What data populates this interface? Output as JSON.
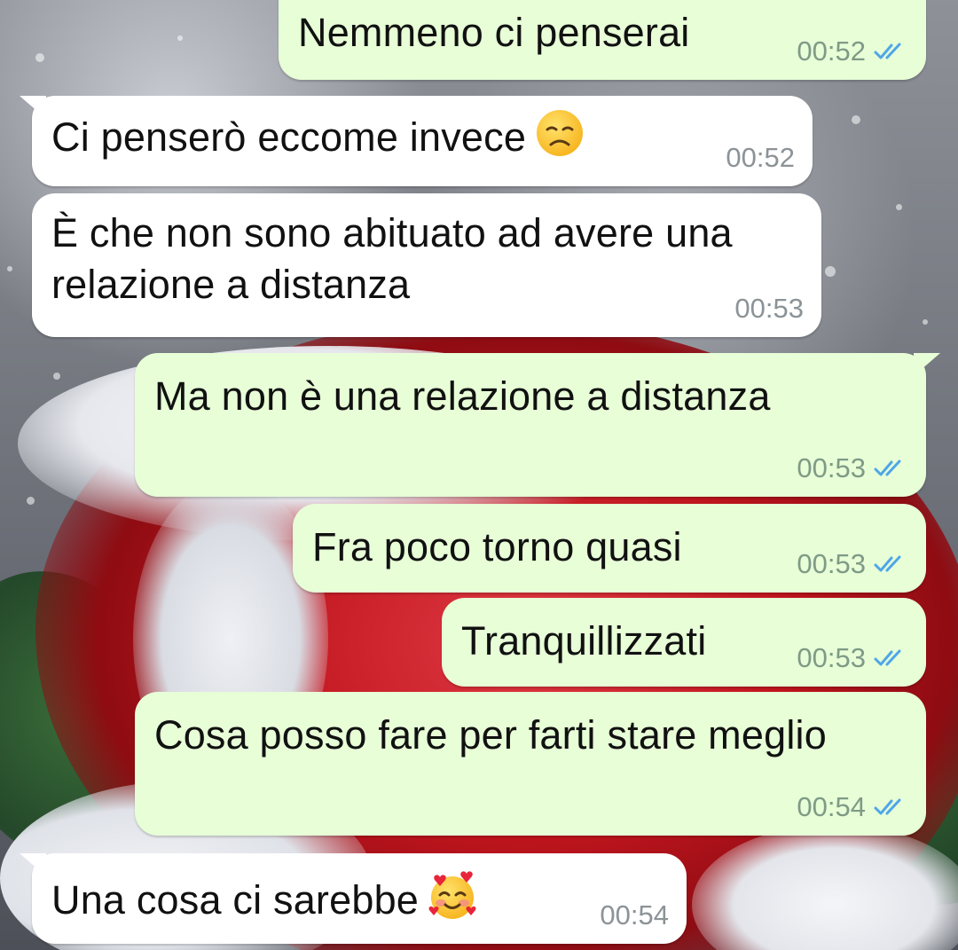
{
  "theme": {
    "incoming_bubble": "#ffffff",
    "outgoing_bubble": "#e7fed7",
    "read_tick_color": "#4fa6e8"
  },
  "messages": [
    {
      "id": "m1",
      "direction": "out",
      "text": "Nemmeno ci penserai",
      "time": "00:52",
      "status": "read"
    },
    {
      "id": "m2",
      "direction": "in",
      "text": "Ci penserò eccome invece",
      "emoji": "disappointed-face-icon",
      "time": "00:52"
    },
    {
      "id": "m3",
      "direction": "in",
      "text": "È che non sono abituato ad avere una relazione a distanza",
      "time": "00:53"
    },
    {
      "id": "m4",
      "direction": "out",
      "text": "Ma non è una relazione a distanza",
      "time": "00:53",
      "status": "read"
    },
    {
      "id": "m5",
      "direction": "out",
      "text": "Fra poco torno quasi",
      "time": "00:53",
      "status": "read"
    },
    {
      "id": "m6",
      "direction": "out",
      "text": "Tranquillizzati",
      "time": "00:53",
      "status": "read"
    },
    {
      "id": "m7",
      "direction": "out",
      "text": "Cosa posso fare per farti stare meglio",
      "time": "00:54",
      "status": "read"
    },
    {
      "id": "m8",
      "direction": "in",
      "text": "Una cosa ci sarebbe",
      "emoji": "smiling-face-with-hearts-icon",
      "time": "00:54"
    }
  ]
}
